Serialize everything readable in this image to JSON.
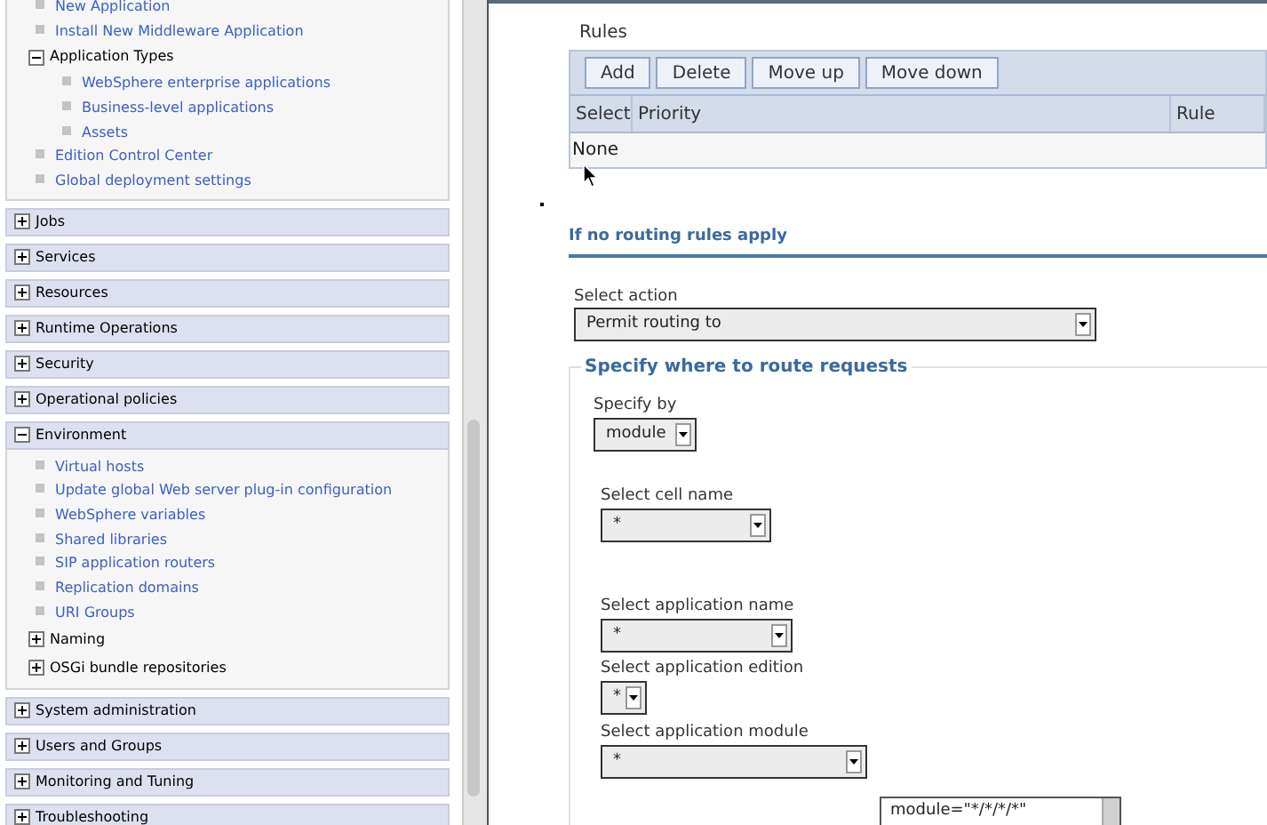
{
  "nav": {
    "tree_items": [
      {
        "label": "New Application",
        "kind": "link"
      },
      {
        "label": "Install New Middleware Application",
        "kind": "link"
      },
      {
        "label": "Application Types",
        "kind": "folder",
        "expanded": true,
        "children": [
          {
            "label": "WebSphere enterprise applications",
            "kind": "link"
          },
          {
            "label": "Business-level applications",
            "kind": "link"
          },
          {
            "label": "Assets",
            "kind": "link"
          }
        ]
      },
      {
        "label": "Edition Control Center",
        "kind": "link"
      },
      {
        "label": "Global deployment settings",
        "kind": "link"
      }
    ],
    "sections": [
      {
        "label": "Jobs",
        "expanded": false
      },
      {
        "label": "Services",
        "expanded": false
      },
      {
        "label": "Resources",
        "expanded": false
      },
      {
        "label": "Runtime Operations",
        "expanded": false
      },
      {
        "label": "Security",
        "expanded": false
      },
      {
        "label": "Operational policies",
        "expanded": false
      },
      {
        "label": "Environment",
        "expanded": true,
        "children": [
          {
            "label": "Virtual hosts",
            "kind": "link"
          },
          {
            "label": "Update global Web server plug-in configuration",
            "kind": "link"
          },
          {
            "label": "WebSphere variables",
            "kind": "link"
          },
          {
            "label": "Shared libraries",
            "kind": "link"
          },
          {
            "label": "SIP application routers",
            "kind": "link"
          },
          {
            "label": "Replication domains",
            "kind": "link"
          },
          {
            "label": "URI Groups",
            "kind": "link"
          },
          {
            "label": "Naming",
            "kind": "folder",
            "expanded": false
          },
          {
            "label": "OSGi bundle repositories",
            "kind": "folder",
            "expanded": false
          }
        ]
      },
      {
        "label": "System administration",
        "expanded": false
      },
      {
        "label": "Users and Groups",
        "expanded": false
      },
      {
        "label": "Monitoring and Tuning",
        "expanded": false
      },
      {
        "label": "Troubleshooting",
        "expanded": false
      }
    ]
  },
  "rules": {
    "title": "Rules",
    "buttons": [
      "Add",
      "Delete",
      "Move up",
      "Move down"
    ],
    "columns": [
      "Select",
      "Priority",
      "Rule"
    ],
    "empty_text": "None"
  },
  "fallback": {
    "heading": "If no routing rules apply",
    "select_action": {
      "label": "Select action",
      "value": "Permit routing to"
    },
    "route": {
      "legend": "Specify where to route requests",
      "fields": [
        {
          "label": "Specify by",
          "value": "module"
        },
        {
          "label": "Select cell name",
          "value": "*"
        },
        {
          "label": "Select application name",
          "value": "*"
        },
        {
          "label": "Select application edition",
          "value": "*"
        },
        {
          "label": "Select application module",
          "value": "*"
        }
      ],
      "expression": "module=\"*/*/*/*\""
    }
  }
}
